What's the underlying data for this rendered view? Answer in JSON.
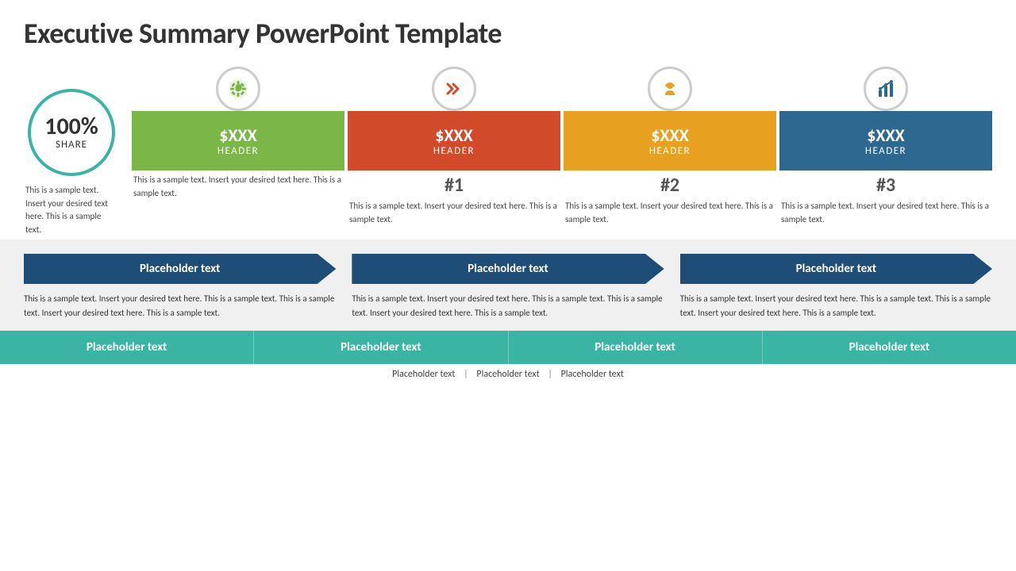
{
  "title": "Executive Summary PowerPoint Template",
  "circle": {
    "percent": "100%",
    "label": "SHARE",
    "description": "This is a sample text. Insert your desired text here. This is a sample text."
  },
  "cards": [
    {
      "id": "card-1",
      "color": "green",
      "value": "$XXX",
      "header": "HEADER",
      "rank": "",
      "description": "This is a sample text. Insert your desired text here. This is a sample text.",
      "icon": "leaf"
    },
    {
      "id": "card-2",
      "color": "red",
      "value": "$XXX",
      "header": "HEADER",
      "rank": "#1",
      "description": "This is a sample text. Insert your desired text here. This is a sample text.",
      "icon": "arrows"
    },
    {
      "id": "card-3",
      "color": "orange",
      "value": "$XXX",
      "header": "HEADER",
      "rank": "#2",
      "description": "This is a sample text. Insert your desired text here. This is a sample text.",
      "icon": "person"
    },
    {
      "id": "card-4",
      "color": "blue",
      "value": "$XXX",
      "header": "HEADER",
      "rank": "#3",
      "description": "This is a sample text. Insert your desired text here. This is a sample text.",
      "icon": "chart"
    }
  ],
  "mid_columns": [
    {
      "banner": "Placeholder text",
      "description": "This is a sample text. Insert your desired text here. This is a sample text. This is a sample text. Insert your desired text here. This is a sample text."
    },
    {
      "banner": "Placeholder text",
      "description": "This is a sample text. Insert your desired text here. This is a sample text. This is a sample text. Insert your desired text here. This is a sample text."
    },
    {
      "banner": "Placeholder text",
      "description": "This is a sample text. Insert your desired text here. This is a sample text. This is a sample text. Insert your desired text here. This is a sample text."
    }
  ],
  "bottom_bars": [
    "Placeholder text",
    "Placeholder text",
    "Placeholder text",
    "Placeholder text"
  ],
  "footer_links": [
    "Placeholder text",
    "Placeholder text",
    "Placeholder text"
  ]
}
